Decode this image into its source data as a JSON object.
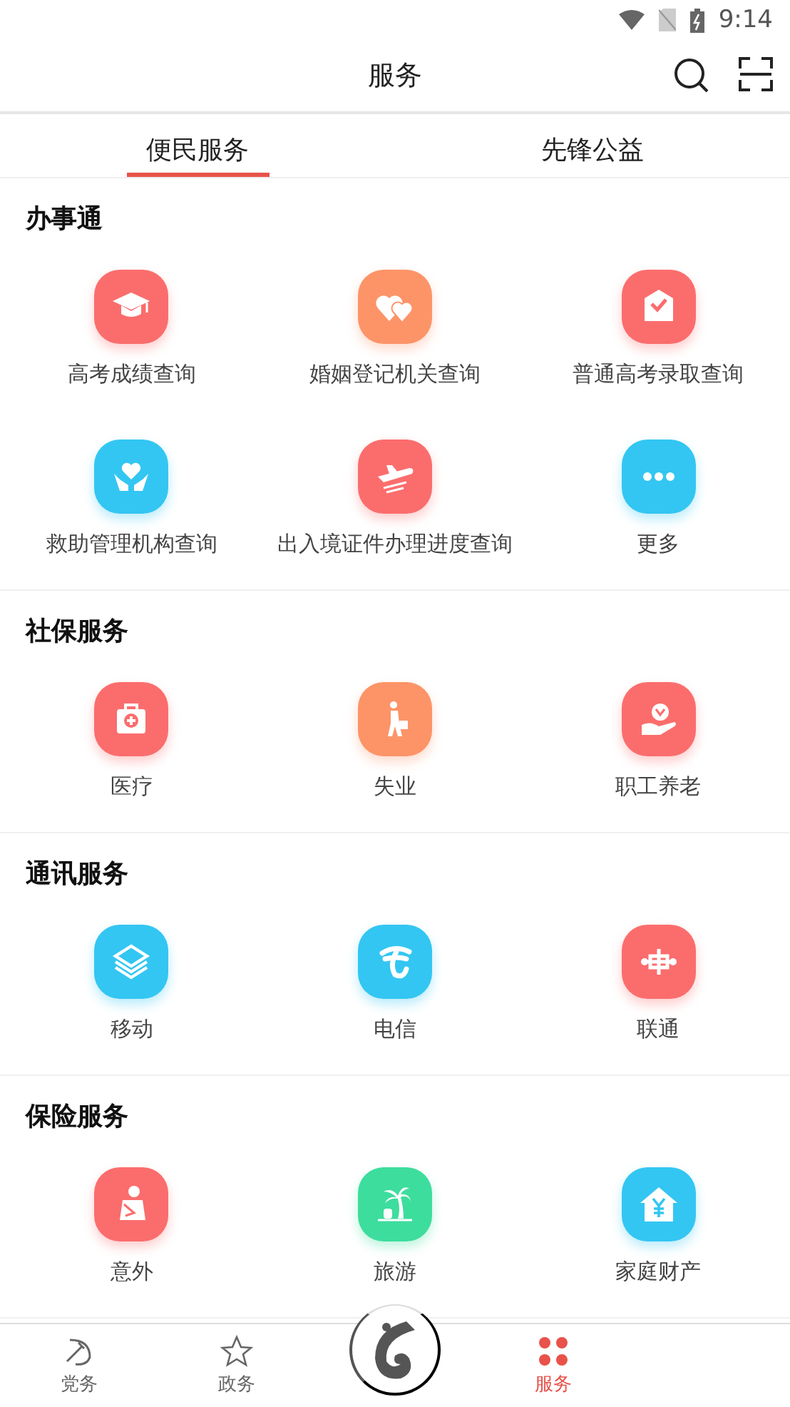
{
  "status_bar": {
    "time": "9:14"
  },
  "header": {
    "title": "服务"
  },
  "tabs": [
    {
      "label": "便民服务",
      "selected": true
    },
    {
      "label": "先锋公益",
      "selected": false
    }
  ],
  "sections": [
    {
      "title": "办事通",
      "items": [
        {
          "label": "高考成绩查询",
          "kind": "cap",
          "color": "#fb6d6d"
        },
        {
          "label": "婚姻登记机关查询",
          "kind": "hearts",
          "color": "#fd9468"
        },
        {
          "label": "普通高考录取查询",
          "kind": "envelope",
          "color": "#fb6d6d"
        },
        {
          "label": "救助管理机构查询",
          "kind": "handheart",
          "color": "#33c6f2"
        },
        {
          "label": "出入境证件办理进度查询",
          "kind": "plane",
          "color": "#fb6d6d"
        },
        {
          "label": "更多",
          "kind": "dots",
          "color": "#33c6f2"
        }
      ]
    },
    {
      "title": "社保服务",
      "items": [
        {
          "label": "医疗",
          "kind": "medkit",
          "color": "#fb6d6d"
        },
        {
          "label": "失业",
          "kind": "walker",
          "color": "#fd9468"
        },
        {
          "label": "职工养老",
          "kind": "hand",
          "color": "#fb6d6d"
        }
      ]
    },
    {
      "title": "通讯服务",
      "items": [
        {
          "label": "移动",
          "kind": "layers",
          "color": "#33c6f2"
        },
        {
          "label": "电信",
          "kind": "swirl",
          "color": "#33c6f2"
        },
        {
          "label": "联通",
          "kind": "knot",
          "color": "#fb6d6d"
        }
      ]
    },
    {
      "title": "保险服务",
      "items": [
        {
          "label": "意外",
          "kind": "injured",
          "color": "#fb6d6d"
        },
        {
          "label": "旅游",
          "kind": "palm",
          "color": "#3ddd9d"
        },
        {
          "label": "家庭财产",
          "kind": "house",
          "color": "#33c6f2"
        }
      ]
    }
  ],
  "bottom_nav": [
    {
      "label": "党务",
      "kind": "emblem",
      "selected": false
    },
    {
      "label": "政务",
      "kind": "star",
      "selected": false
    },
    {
      "kind": "logo",
      "selected": false
    },
    {
      "label": "服务",
      "kind": "grid",
      "selected": true
    }
  ]
}
